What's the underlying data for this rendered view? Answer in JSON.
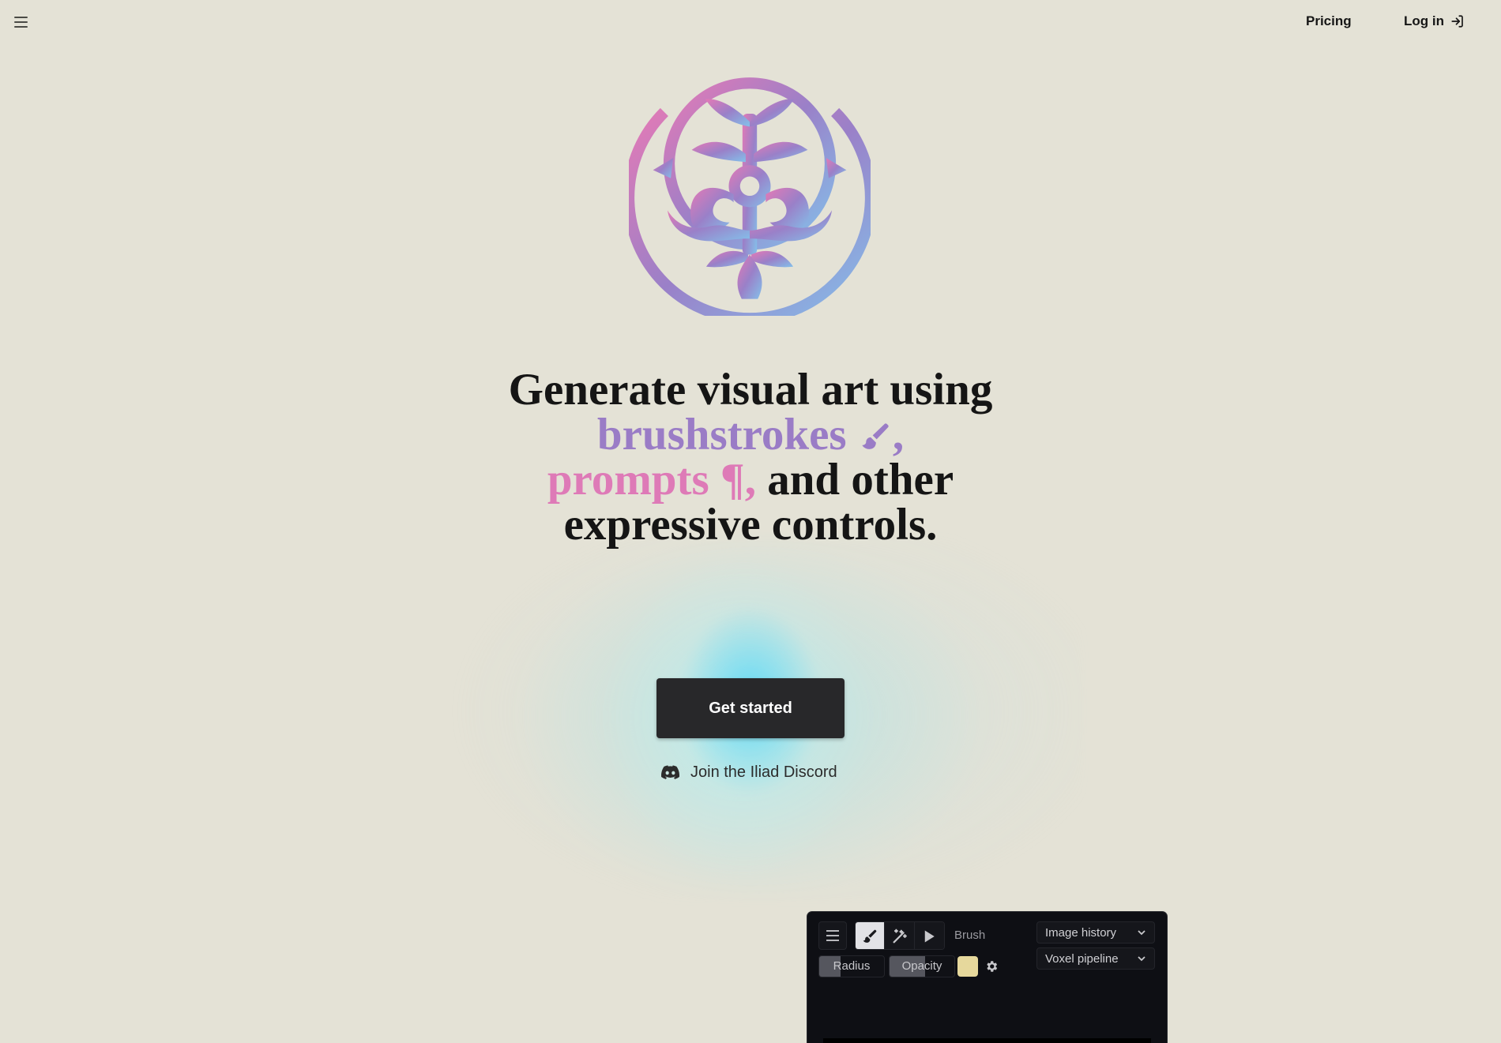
{
  "nav": {
    "menu_icon": "hamburger-icon",
    "pricing_label": "Pricing",
    "login_label": "Log in",
    "login_icon": "login-arrow-icon"
  },
  "logo": {
    "name": "Iliad logo",
    "gradient_colors": [
      "#de7ab7",
      "#9a7cc6",
      "#88b8e6"
    ]
  },
  "hero": {
    "line1": "Generate visual art using",
    "highlight1": "brushstrokes",
    "highlight1_icon": "paintbrush-icon",
    "highlight1_color": "#9a7cc6",
    "comma1": ",",
    "highlight2": "prompts",
    "highlight2_icon": "pilcrow-icon",
    "highlight2_glyph": "¶",
    "highlight2_color": "#de7ab7",
    "comma2": ",",
    "line3_rest": " and other",
    "line4": "expressive controls."
  },
  "cta": {
    "get_started_label": "Get started",
    "discord_label": "Join the Iliad Discord",
    "discord_icon": "discord-icon"
  },
  "app_preview": {
    "tools": [
      {
        "name": "brush",
        "icon": "paintbrush-icon",
        "active": true
      },
      {
        "name": "magic",
        "icon": "magic-wand-icon",
        "active": false
      },
      {
        "name": "select",
        "icon": "pointer-icon",
        "active": false
      }
    ],
    "active_tool_label": "Brush",
    "radius_label": "Radius",
    "radius_value": 0.33,
    "opacity_label": "Opacity",
    "opacity_value": 0.55,
    "color_swatch": "#e6d89c",
    "settings_icon": "gear-icon",
    "dropdowns": [
      {
        "label": "Image history"
      },
      {
        "label": "Voxel pipeline"
      }
    ]
  }
}
